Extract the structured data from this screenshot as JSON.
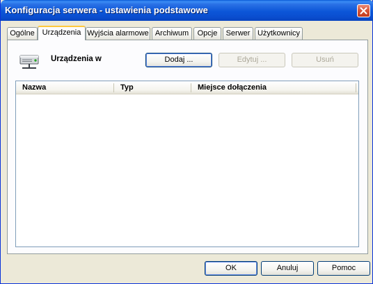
{
  "window": {
    "title": "Konfiguracja serwera - ustawienia podstawowe",
    "titlebar_color": "#0a55d6"
  },
  "tabs": [
    {
      "label": "Ogólne",
      "active": false
    },
    {
      "label": "Urządzenia",
      "active": true
    },
    {
      "label": "Wyjścia alarmowe",
      "active": false
    },
    {
      "label": "Archiwum",
      "active": false
    },
    {
      "label": "Opcje",
      "active": false
    },
    {
      "label": "Serwer",
      "active": false
    },
    {
      "label": "Użytkownicy",
      "active": false
    }
  ],
  "devices": {
    "icon": "network-device-icon",
    "heading": "Urządzenia w",
    "add_label": "Dodaj ...",
    "edit_label": "Edytuj ...",
    "delete_label": "Usuń",
    "columns": [
      "Nazwa",
      "Typ",
      "Miejsce dołączenia"
    ],
    "rows": []
  },
  "footer": {
    "ok_label": "OK",
    "cancel_label": "Anuluj",
    "help_label": "Pomoc"
  }
}
